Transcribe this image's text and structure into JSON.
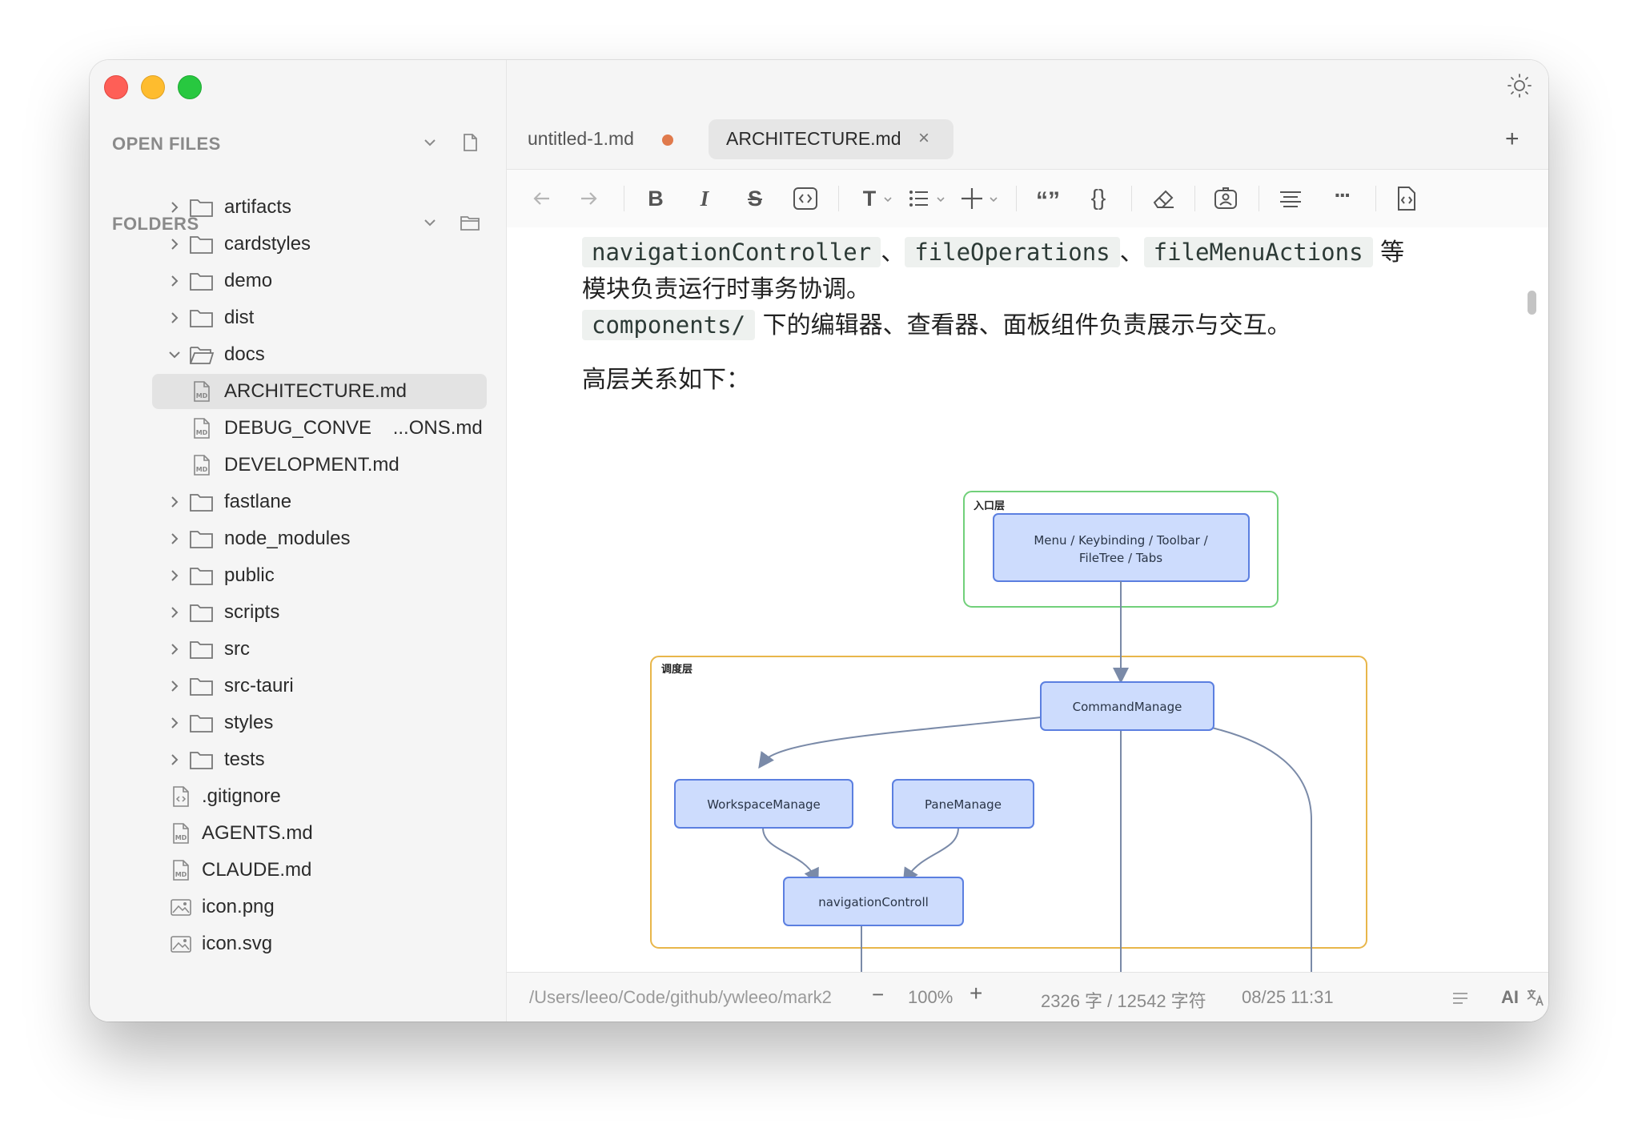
{
  "sidebar": {
    "open_files_title": "OPEN FILES",
    "folders_title": "FOLDERS",
    "tree": [
      {
        "label": "artifacts",
        "type": "folder"
      },
      {
        "label": "cardstyles",
        "type": "folder"
      },
      {
        "label": "demo",
        "type": "folder"
      },
      {
        "label": "dist",
        "type": "folder"
      },
      {
        "label": "docs",
        "type": "folder-open"
      },
      {
        "label": "ARCHITECTURE.md",
        "type": "md",
        "selected": true
      },
      {
        "label": "DEBUG_CONVE    ...ONS.md",
        "type": "md"
      },
      {
        "label": "DEVELOPMENT.md",
        "type": "md"
      },
      {
        "label": "fastlane",
        "type": "folder"
      },
      {
        "label": "node_modules",
        "type": "folder"
      },
      {
        "label": "public",
        "type": "folder"
      },
      {
        "label": "scripts",
        "type": "folder"
      },
      {
        "label": "src",
        "type": "folder"
      },
      {
        "label": "src-tauri",
        "type": "folder"
      },
      {
        "label": "styles",
        "type": "folder"
      },
      {
        "label": "tests",
        "type": "folder"
      },
      {
        "label": ".gitignore",
        "type": "code-file"
      },
      {
        "label": "AGENTS.md",
        "type": "md"
      },
      {
        "label": "CLAUDE.md",
        "type": "md"
      },
      {
        "label": "icon.png",
        "type": "image"
      },
      {
        "label": "icon.svg",
        "type": "image"
      }
    ]
  },
  "tabs": [
    {
      "label": "untitled-1.md",
      "modified": true,
      "active": false
    },
    {
      "label": "ARCHITECTURE.md",
      "close": "×",
      "active": true
    }
  ],
  "new_tab_label": "+",
  "toolbar_icons": [
    "back-arrow-icon",
    "forward-arrow-icon",
    "bold-icon",
    "italic-icon",
    "strikethrough-icon",
    "inline-code-icon",
    "heading-icon",
    "list-icon",
    "insert-icon",
    "quote-icon",
    "code-block-icon",
    "eraser-icon",
    "image-icon",
    "align-icon",
    "more-icon",
    "source-code-icon"
  ],
  "toolbar_glyphs": {
    "bold": "B",
    "italic": "I",
    "strike": "S",
    "heading": "T",
    "quote": "“”",
    "braces": "{}",
    "more": "···"
  },
  "document": {
    "line1": {
      "code1": "navigationController",
      "sep1": "、",
      "code2": "fileOperations",
      "sep2": "、",
      "code3": "fileMenuActions",
      "tail": " 等"
    },
    "line2": "模块负责运行时事务协调。",
    "line3": {
      "code": "components/",
      "text": " 下的编辑器、查看器、面板组件负责展示与交互。"
    },
    "line4": "高层关系如下："
  },
  "diagram": {
    "entry_group_label": "入口层",
    "entry_node_line1": "Menu / Keybinding / Toolbar /",
    "entry_node_line2": "FileTree / Tabs",
    "dispatch_group_label": "调度层",
    "command_node": "CommandManage",
    "workspace_node": "WorkspaceManage",
    "pane_node": "PaneManage",
    "navigation_node": "navigationControll"
  },
  "status": {
    "path": "/Users/leeo/Code/github/ywleeo/mark2",
    "zoom_minus": "−",
    "zoom": "100%",
    "zoom_plus": "+",
    "count": "2326 字 / 12542 字符",
    "time": "08/25 11:31",
    "ai": "AI"
  },
  "colors": {
    "accent_dot": "#e07a4c",
    "node_fill": "#cddcfd",
    "node_stroke": "#5b7fe0",
    "entry_border": "#71d07a",
    "dispatch_border": "#e8b64a"
  }
}
